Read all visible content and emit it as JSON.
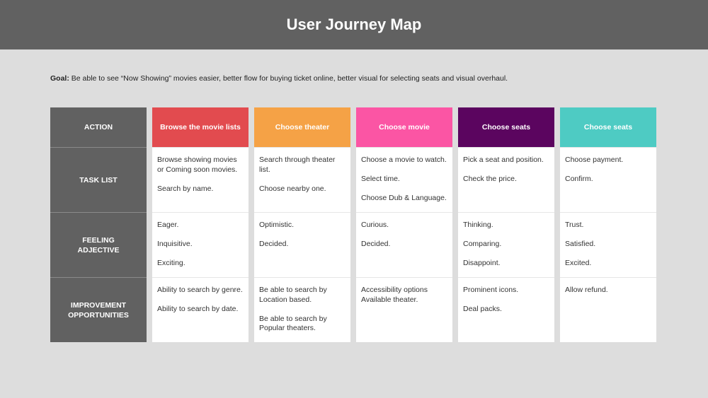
{
  "title": "User Journey Map",
  "goal": {
    "label": "Goal:",
    "text": " Be able to see “Now Showing” movies easier, better flow for buying ticket online, better visual for selecting seats and visual overhaul."
  },
  "row_labels": [
    "ACTION",
    "TASK LIST",
    "FEELING ADJECTIVE",
    "IMPROVEMENT OPPORTUNITIES"
  ],
  "stages": [
    {
      "action": "Browse the movie lists",
      "color": "#e24b4f",
      "tasks": [
        "Browse showing movies or Coming soon movies.",
        "Search by name."
      ],
      "feelings": [
        "Eager.",
        "Inquisitive.",
        "Exciting."
      ],
      "opportunities": [
        "Ability to search by genre.",
        "Ability to search by date."
      ]
    },
    {
      "action": "Choose theater",
      "color": "#f5a246",
      "tasks": [
        "Search through theater list.",
        "Choose nearby one."
      ],
      "feelings": [
        "Optimistic.",
        "Decided."
      ],
      "opportunities": [
        "Be able to search by Location based.",
        "Be able to search by Popular theaters."
      ]
    },
    {
      "action": "Choose movie",
      "color": "#fb55a4",
      "tasks": [
        "Choose a movie to watch.",
        "Select time.",
        "Choose Dub & Language."
      ],
      "feelings": [
        "Curious.",
        "Decided."
      ],
      "opportunities": [
        "Accessibility options Available theater."
      ]
    },
    {
      "action": "Choose seats",
      "color": "#5b055f",
      "tasks": [
        "Pick a seat and position.",
        "Check the price."
      ],
      "feelings": [
        "Thinking.",
        "Comparing.",
        "Disappoint."
      ],
      "opportunities": [
        "Prominent icons.",
        "Deal packs."
      ]
    },
    {
      "action": "Choose seats",
      "color": "#4ecbc3",
      "tasks": [
        "Choose payment.",
        "Confirm."
      ],
      "feelings": [
        "Trust.",
        "Satisfied.",
        "Excited."
      ],
      "opportunities": [
        "Allow refund."
      ]
    }
  ]
}
